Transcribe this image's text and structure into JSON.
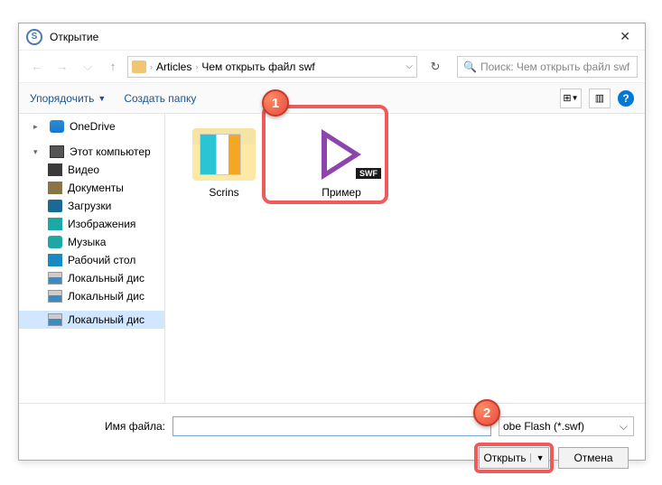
{
  "titlebar": {
    "app_icon_letter": "S",
    "title": "Открытие"
  },
  "breadcrumb": {
    "seg1": "Articles",
    "seg2": "Чем открыть файл swf"
  },
  "search": {
    "placeholder": "Поиск: Чем открыть файл swf"
  },
  "toolbar": {
    "organize": "Упорядочить",
    "new_folder": "Создать папку"
  },
  "sidebar": {
    "items": [
      {
        "label": "OneDrive",
        "icon": "ic-onedrive"
      },
      {
        "label": "Этот компьютер",
        "icon": "ic-pc"
      },
      {
        "label": "Видео",
        "icon": "ic-video"
      },
      {
        "label": "Документы",
        "icon": "ic-doc"
      },
      {
        "label": "Загрузки",
        "icon": "ic-download"
      },
      {
        "label": "Изображения",
        "icon": "ic-image"
      },
      {
        "label": "Музыка",
        "icon": "ic-music"
      },
      {
        "label": "Рабочий стол",
        "icon": "ic-desktop"
      },
      {
        "label": "Локальный дис",
        "icon": "ic-disk"
      },
      {
        "label": "Локальный дис",
        "icon": "ic-disk"
      },
      {
        "label": "Локальный дис",
        "icon": "ic-disk"
      }
    ]
  },
  "files": {
    "folder_name": "Scrins",
    "swf_name": "Пример",
    "swf_badge": "SWF"
  },
  "footer": {
    "filename_label": "Имя файла:",
    "filename_value": "",
    "filter_label": "obe Flash (*.swf)",
    "open": "Открыть",
    "cancel": "Отмена"
  },
  "markers": {
    "m1": "1",
    "m2": "2"
  }
}
